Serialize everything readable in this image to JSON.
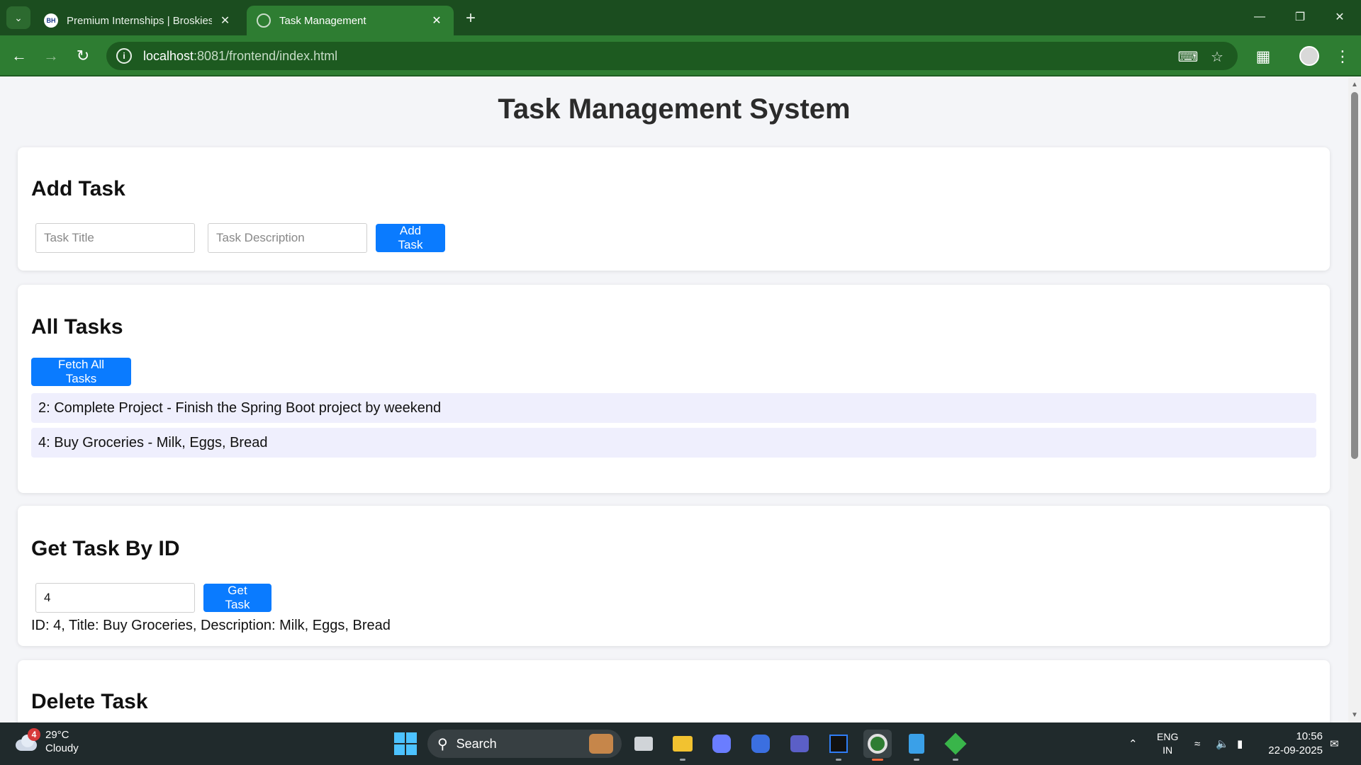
{
  "browser": {
    "tabs": [
      {
        "title": "Premium Internships | BroskiesHub",
        "favicon": "BH",
        "active": false
      },
      {
        "title": "Task Management",
        "favicon": "globe-icon",
        "active": true
      }
    ],
    "url_host": "localhost",
    "url_path": ":8081/frontend/index.html",
    "accent_color": "#2e7d32"
  },
  "page": {
    "title": "Task Management System",
    "add_task": {
      "heading": "Add Task",
      "title_placeholder": "Task Title",
      "description_placeholder": "Task Description",
      "button_label": "Add Task"
    },
    "all_tasks": {
      "heading": "All Tasks",
      "button_label": "Fetch All Tasks",
      "items": [
        "2: Complete Project - Finish the Spring Boot project by weekend",
        "4: Buy Groceries - Milk, Eggs, Bread"
      ]
    },
    "get_task": {
      "heading": "Get Task By ID",
      "id_value": "4",
      "button_label": "Get Task",
      "result": "ID: 4, Title: Buy Groceries, Description: Milk, Eggs, Bread"
    },
    "delete_task": {
      "heading": "Delete Task"
    },
    "button_color": "#0a7bff"
  },
  "taskbar": {
    "weather_temp": "29°C",
    "weather_desc": "Cloudy",
    "weather_badge": "4",
    "search_label": "Search",
    "language_top": "ENG",
    "language_bottom": "IN",
    "time": "10:56",
    "date": "22-09-2025"
  }
}
